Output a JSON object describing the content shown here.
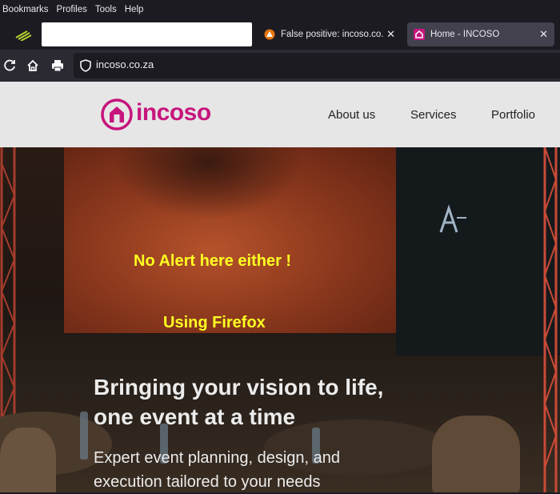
{
  "menubar": {
    "items": [
      "Bookmarks",
      "Profiles",
      "Tools",
      "Help"
    ]
  },
  "tabs": [
    {
      "title": "False positive: incoso.co.za flag",
      "icon": "warning-favicon",
      "active": false
    },
    {
      "title": "Home - INCOSO",
      "icon": "incoso-favicon",
      "active": true
    }
  ],
  "toolbar": {
    "url": "incoso.co.za"
  },
  "site": {
    "logo_text": "incoso",
    "nav": [
      "About us",
      "Services",
      "Portfolio"
    ],
    "brand_color": "#c7157d"
  },
  "annotations": {
    "line1": "No Alert here either !",
    "line2": "Using Firefox"
  },
  "hero": {
    "title_line1": "Bringing your vision to life,",
    "title_line2": "one event at a time",
    "sub_line1": "Expert event planning, design, and",
    "sub_line2": "execution tailored to your needs"
  }
}
